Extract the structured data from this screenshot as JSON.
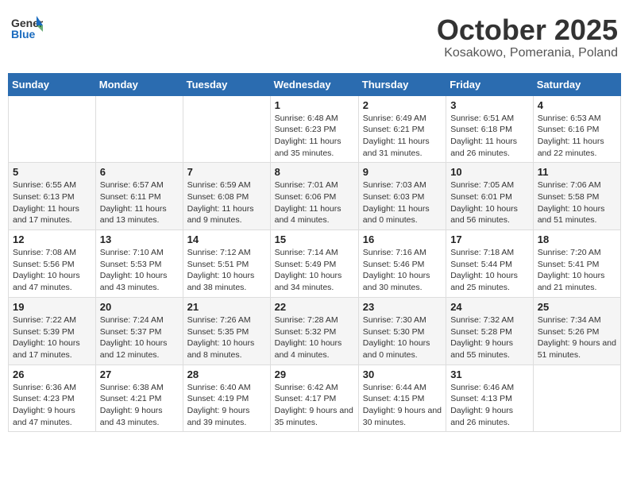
{
  "header": {
    "logo_general": "General",
    "logo_blue": "Blue",
    "month_title": "October 2025",
    "location": "Kosakowo, Pomerania, Poland"
  },
  "weekdays": [
    "Sunday",
    "Monday",
    "Tuesday",
    "Wednesday",
    "Thursday",
    "Friday",
    "Saturday"
  ],
  "weeks": [
    {
      "shaded": false,
      "days": [
        null,
        null,
        null,
        {
          "number": "1",
          "sunrise": "Sunrise: 6:48 AM",
          "sunset": "Sunset: 6:23 PM",
          "daylight": "Daylight: 11 hours and 35 minutes."
        },
        {
          "number": "2",
          "sunrise": "Sunrise: 6:49 AM",
          "sunset": "Sunset: 6:21 PM",
          "daylight": "Daylight: 11 hours and 31 minutes."
        },
        {
          "number": "3",
          "sunrise": "Sunrise: 6:51 AM",
          "sunset": "Sunset: 6:18 PM",
          "daylight": "Daylight: 11 hours and 26 minutes."
        },
        {
          "number": "4",
          "sunrise": "Sunrise: 6:53 AM",
          "sunset": "Sunset: 6:16 PM",
          "daylight": "Daylight: 11 hours and 22 minutes."
        }
      ]
    },
    {
      "shaded": true,
      "days": [
        {
          "number": "5",
          "sunrise": "Sunrise: 6:55 AM",
          "sunset": "Sunset: 6:13 PM",
          "daylight": "Daylight: 11 hours and 17 minutes."
        },
        {
          "number": "6",
          "sunrise": "Sunrise: 6:57 AM",
          "sunset": "Sunset: 6:11 PM",
          "daylight": "Daylight: 11 hours and 13 minutes."
        },
        {
          "number": "7",
          "sunrise": "Sunrise: 6:59 AM",
          "sunset": "Sunset: 6:08 PM",
          "daylight": "Daylight: 11 hours and 9 minutes."
        },
        {
          "number": "8",
          "sunrise": "Sunrise: 7:01 AM",
          "sunset": "Sunset: 6:06 PM",
          "daylight": "Daylight: 11 hours and 4 minutes."
        },
        {
          "number": "9",
          "sunrise": "Sunrise: 7:03 AM",
          "sunset": "Sunset: 6:03 PM",
          "daylight": "Daylight: 11 hours and 0 minutes."
        },
        {
          "number": "10",
          "sunrise": "Sunrise: 7:05 AM",
          "sunset": "Sunset: 6:01 PM",
          "daylight": "Daylight: 10 hours and 56 minutes."
        },
        {
          "number": "11",
          "sunrise": "Sunrise: 7:06 AM",
          "sunset": "Sunset: 5:58 PM",
          "daylight": "Daylight: 10 hours and 51 minutes."
        }
      ]
    },
    {
      "shaded": false,
      "days": [
        {
          "number": "12",
          "sunrise": "Sunrise: 7:08 AM",
          "sunset": "Sunset: 5:56 PM",
          "daylight": "Daylight: 10 hours and 47 minutes."
        },
        {
          "number": "13",
          "sunrise": "Sunrise: 7:10 AM",
          "sunset": "Sunset: 5:53 PM",
          "daylight": "Daylight: 10 hours and 43 minutes."
        },
        {
          "number": "14",
          "sunrise": "Sunrise: 7:12 AM",
          "sunset": "Sunset: 5:51 PM",
          "daylight": "Daylight: 10 hours and 38 minutes."
        },
        {
          "number": "15",
          "sunrise": "Sunrise: 7:14 AM",
          "sunset": "Sunset: 5:49 PM",
          "daylight": "Daylight: 10 hours and 34 minutes."
        },
        {
          "number": "16",
          "sunrise": "Sunrise: 7:16 AM",
          "sunset": "Sunset: 5:46 PM",
          "daylight": "Daylight: 10 hours and 30 minutes."
        },
        {
          "number": "17",
          "sunrise": "Sunrise: 7:18 AM",
          "sunset": "Sunset: 5:44 PM",
          "daylight": "Daylight: 10 hours and 25 minutes."
        },
        {
          "number": "18",
          "sunrise": "Sunrise: 7:20 AM",
          "sunset": "Sunset: 5:41 PM",
          "daylight": "Daylight: 10 hours and 21 minutes."
        }
      ]
    },
    {
      "shaded": true,
      "days": [
        {
          "number": "19",
          "sunrise": "Sunrise: 7:22 AM",
          "sunset": "Sunset: 5:39 PM",
          "daylight": "Daylight: 10 hours and 17 minutes."
        },
        {
          "number": "20",
          "sunrise": "Sunrise: 7:24 AM",
          "sunset": "Sunset: 5:37 PM",
          "daylight": "Daylight: 10 hours and 12 minutes."
        },
        {
          "number": "21",
          "sunrise": "Sunrise: 7:26 AM",
          "sunset": "Sunset: 5:35 PM",
          "daylight": "Daylight: 10 hours and 8 minutes."
        },
        {
          "number": "22",
          "sunrise": "Sunrise: 7:28 AM",
          "sunset": "Sunset: 5:32 PM",
          "daylight": "Daylight: 10 hours and 4 minutes."
        },
        {
          "number": "23",
          "sunrise": "Sunrise: 7:30 AM",
          "sunset": "Sunset: 5:30 PM",
          "daylight": "Daylight: 10 hours and 0 minutes."
        },
        {
          "number": "24",
          "sunrise": "Sunrise: 7:32 AM",
          "sunset": "Sunset: 5:28 PM",
          "daylight": "Daylight: 9 hours and 55 minutes."
        },
        {
          "number": "25",
          "sunrise": "Sunrise: 7:34 AM",
          "sunset": "Sunset: 5:26 PM",
          "daylight": "Daylight: 9 hours and 51 minutes."
        }
      ]
    },
    {
      "shaded": false,
      "days": [
        {
          "number": "26",
          "sunrise": "Sunrise: 6:36 AM",
          "sunset": "Sunset: 4:23 PM",
          "daylight": "Daylight: 9 hours and 47 minutes."
        },
        {
          "number": "27",
          "sunrise": "Sunrise: 6:38 AM",
          "sunset": "Sunset: 4:21 PM",
          "daylight": "Daylight: 9 hours and 43 minutes."
        },
        {
          "number": "28",
          "sunrise": "Sunrise: 6:40 AM",
          "sunset": "Sunset: 4:19 PM",
          "daylight": "Daylight: 9 hours and 39 minutes."
        },
        {
          "number": "29",
          "sunrise": "Sunrise: 6:42 AM",
          "sunset": "Sunset: 4:17 PM",
          "daylight": "Daylight: 9 hours and 35 minutes."
        },
        {
          "number": "30",
          "sunrise": "Sunrise: 6:44 AM",
          "sunset": "Sunset: 4:15 PM",
          "daylight": "Daylight: 9 hours and 30 minutes."
        },
        {
          "number": "31",
          "sunrise": "Sunrise: 6:46 AM",
          "sunset": "Sunset: 4:13 PM",
          "daylight": "Daylight: 9 hours and 26 minutes."
        },
        null
      ]
    }
  ]
}
